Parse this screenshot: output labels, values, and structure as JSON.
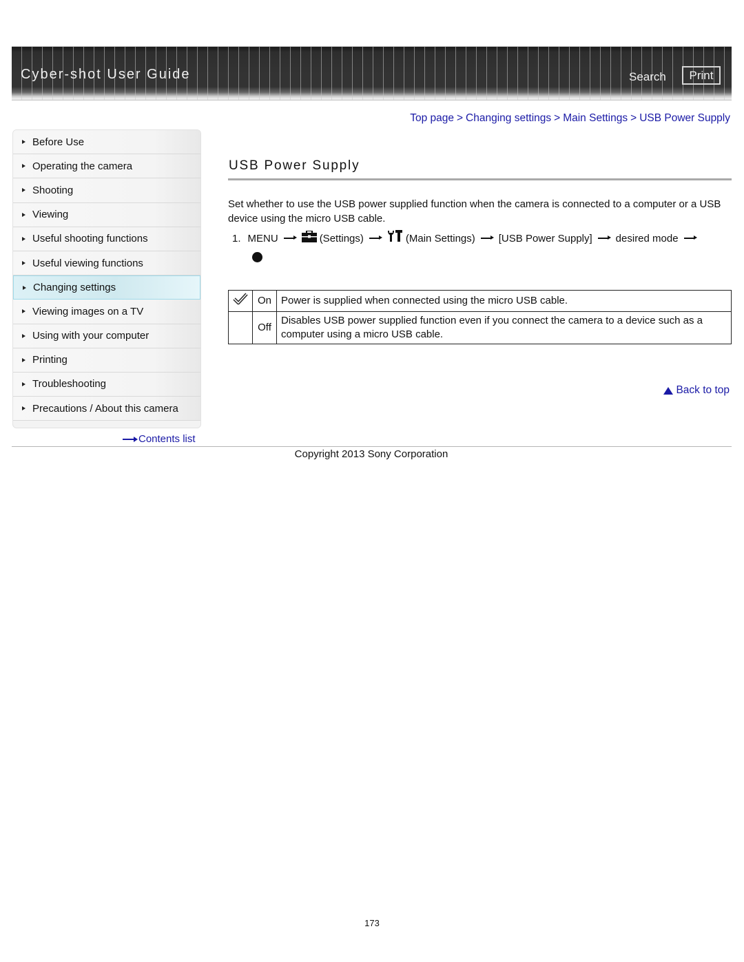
{
  "header": {
    "title": "Cyber-shot User Guide",
    "search_label": "Search",
    "print_label": "Print"
  },
  "breadcrumb": [
    {
      "label": "Top page"
    },
    {
      "label": "Changing settings"
    },
    {
      "label": "Main Settings"
    },
    {
      "label": "USB Power Supply"
    }
  ],
  "breadcrumb_separator": ">",
  "sidebar": {
    "items": [
      {
        "label": "Before Use",
        "active": false
      },
      {
        "label": "Operating the camera",
        "active": false
      },
      {
        "label": "Shooting",
        "active": false
      },
      {
        "label": "Viewing",
        "active": false
      },
      {
        "label": "Useful shooting functions",
        "active": false
      },
      {
        "label": "Useful viewing functions",
        "active": false
      },
      {
        "label": "Changing settings",
        "active": true
      },
      {
        "label": "Viewing images on a TV",
        "active": false
      },
      {
        "label": "Using with your computer",
        "active": false
      },
      {
        "label": "Printing",
        "active": false
      },
      {
        "label": "Troubleshooting",
        "active": false
      },
      {
        "label": "Precautions / About this camera",
        "active": false
      }
    ],
    "contents_link": "Contents list"
  },
  "main": {
    "title": "USB Power Supply",
    "intro": "Set whether to use the USB power supplied function when the camera is connected to a computer or a USB device using the micro USB cable.",
    "step": {
      "number": "1.",
      "menu": "MENU",
      "settings": "(Settings)",
      "main_settings": "(Main Settings)",
      "item": "[USB Power Supply]",
      "desired": "desired mode"
    },
    "modes": [
      {
        "default": true,
        "mode": "On",
        "description": "Power is supplied when connected using the micro USB cable."
      },
      {
        "default": false,
        "mode": "Off",
        "description": "Disables USB power supplied function even if you connect the camera to a device such as a computer using a micro USB cable."
      }
    ],
    "back_to_top": "Back to top"
  },
  "footer": {
    "copyright": "Copyright 2013 Sony Corporation",
    "page_number": "173"
  },
  "colors": {
    "link": "#1a1aa6",
    "active_nav": "#cfe9ef",
    "banner": "#333333"
  }
}
